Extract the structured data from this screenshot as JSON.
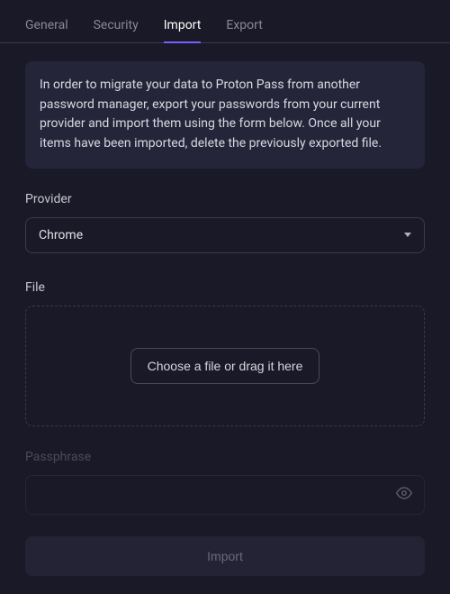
{
  "tabs": {
    "general": "General",
    "security": "Security",
    "import": "Import",
    "export": "Export",
    "active": "import"
  },
  "info_text": "In order to migrate your data to Proton Pass from another password manager, export your passwords from your current provider and import them using the form below. Once all your items have been imported, delete the previously exported file.",
  "provider": {
    "label": "Provider",
    "selected": "Chrome"
  },
  "file": {
    "label": "File",
    "button": "Choose a file or drag it here"
  },
  "passphrase": {
    "label": "Passphrase",
    "value": ""
  },
  "import_button": "Import"
}
